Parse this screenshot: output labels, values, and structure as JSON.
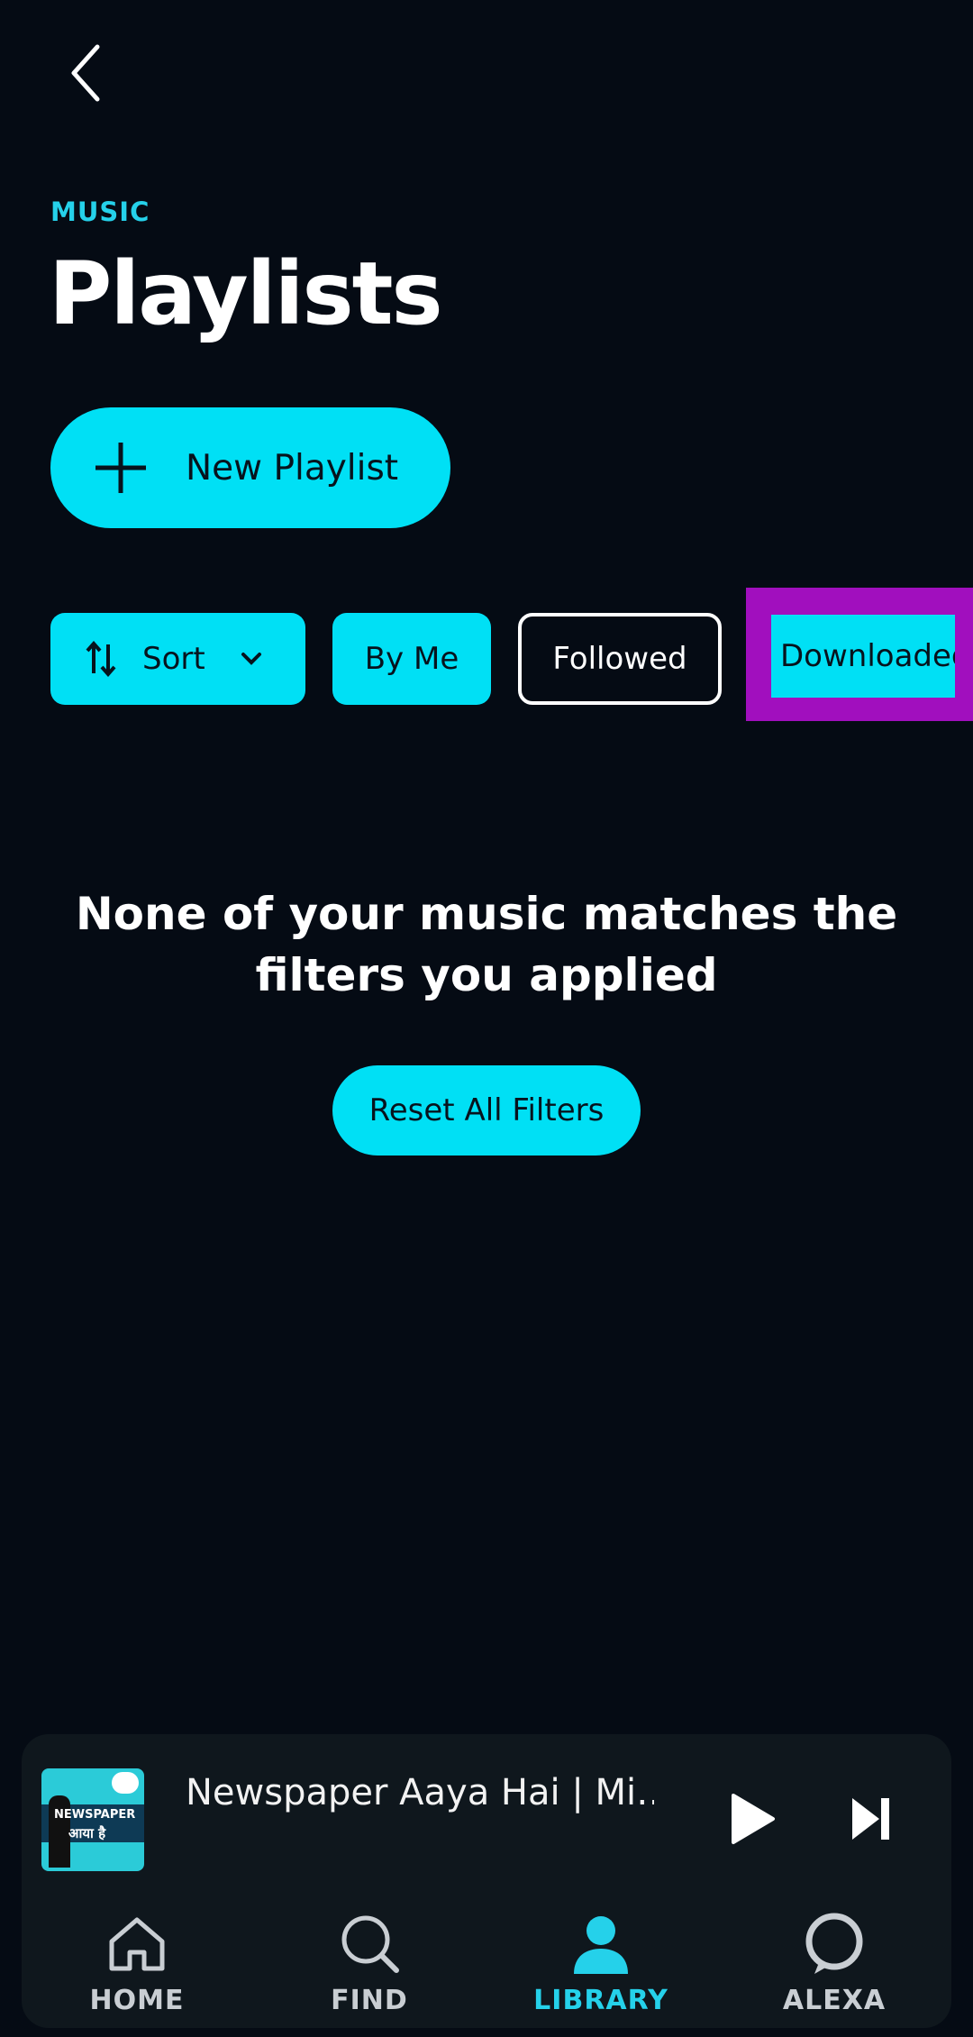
{
  "header": {
    "back_icon": "chevron-left-icon",
    "eyebrow": "MUSIC",
    "title": "Playlists"
  },
  "new_playlist": {
    "label": "New Playlist",
    "icon": "plus-icon"
  },
  "filters": {
    "sort_label": "Sort",
    "by_me_label": "By Me",
    "followed_label": "Followed",
    "downloaded_label": "Downloaded"
  },
  "empty_state": {
    "message": "None of your music matches the filters you applied",
    "reset_label": "Reset All Filters"
  },
  "now_playing": {
    "title": "Newspaper Aaya Hai | Mi…",
    "thumb_text_1": "NEWSPAPER",
    "thumb_text_2": "आया है"
  },
  "nav": {
    "home": "HOME",
    "find": "FIND",
    "library": "LIBRARY",
    "alexa": "ALEXA"
  },
  "colors": {
    "background": "#050b14",
    "accent": "#00e0f5",
    "highlight": "#a10fbe",
    "eyebrow": "#25d1ea"
  }
}
